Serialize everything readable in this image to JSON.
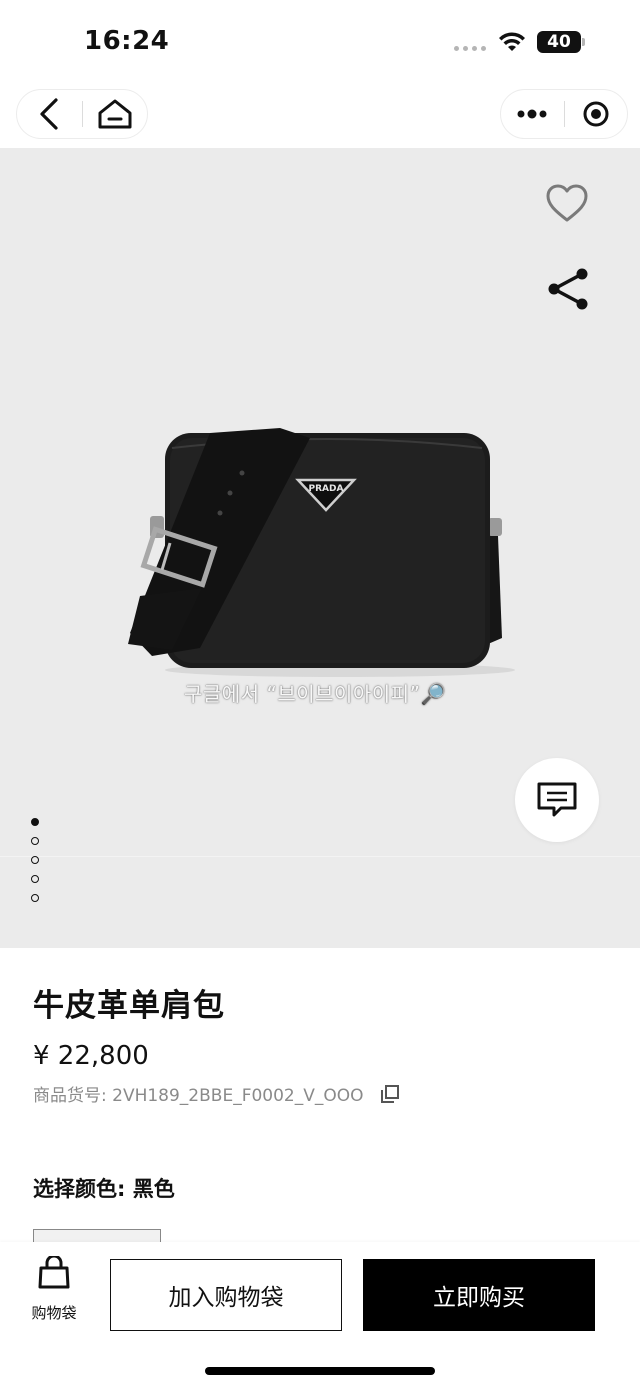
{
  "status_bar": {
    "time": "16:24",
    "battery": "40"
  },
  "nav": {
    "back_icon": "chevron-left-icon",
    "home_icon": "home-icon",
    "more_icon": "more-dots-icon",
    "close_icon": "target-close-icon"
  },
  "gallery": {
    "favorite_icon": "heart-icon",
    "share_icon": "share-icon",
    "chat_icon": "chat-icon",
    "image_logo_text": "PRADA",
    "watermark": "구글에서 “브이브이아이피”🔎",
    "pages": 5,
    "active_page": 1
  },
  "product": {
    "name": "牛皮革单肩包",
    "price": "¥ 22,800",
    "sku": "商品货号: 2VH189_2BBE_F0002_V_OOO",
    "color_label": "选择颜色: 黑色"
  },
  "bottom_bar": {
    "bag_label": "购物袋",
    "add_to_bag": "加入购物袋",
    "buy_now": "立即购买"
  },
  "colors": {
    "gallery_bg": "#ebebeb",
    "primary": "#000000",
    "muted_text": "#8a8a8a"
  }
}
